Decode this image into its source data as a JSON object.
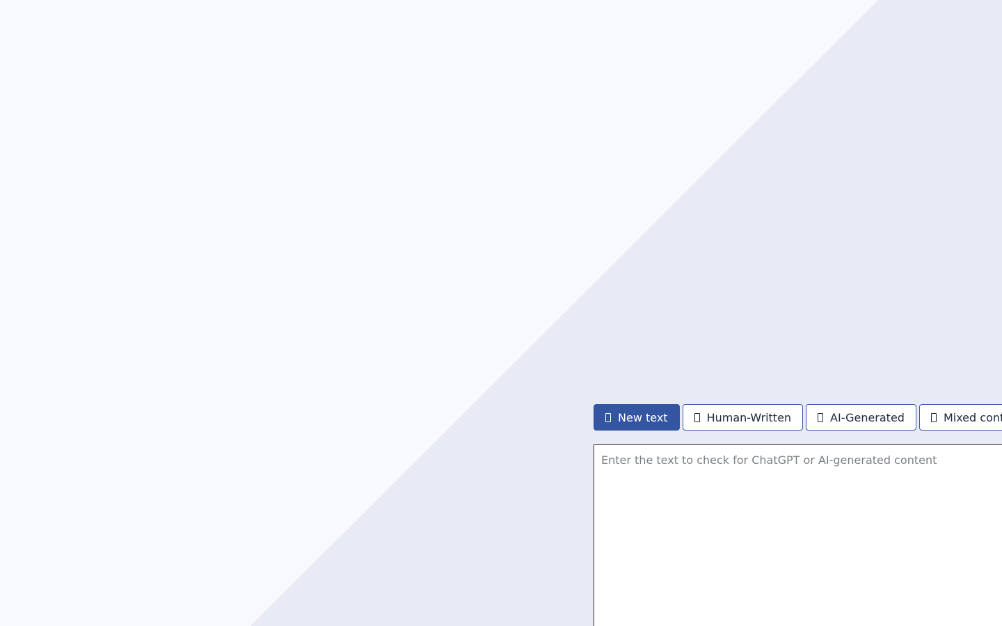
{
  "colors": {
    "page_background": "#f7f9fc",
    "diagonal_band": "#e8ebf6",
    "accent": "#3456a2"
  },
  "tabs": [
    {
      "label": "New text",
      "icon": "document-icon",
      "active": true
    },
    {
      "label": "Human-Written",
      "icon": "person-icon",
      "active": false
    },
    {
      "label": "AI-Generated",
      "icon": "robot-icon",
      "active": false
    },
    {
      "label": "Mixed content",
      "icon": "mixed-icon",
      "active": false
    }
  ],
  "editor": {
    "placeholder": "Enter the text to check for ChatGPT or AI-generated content",
    "value": ""
  }
}
